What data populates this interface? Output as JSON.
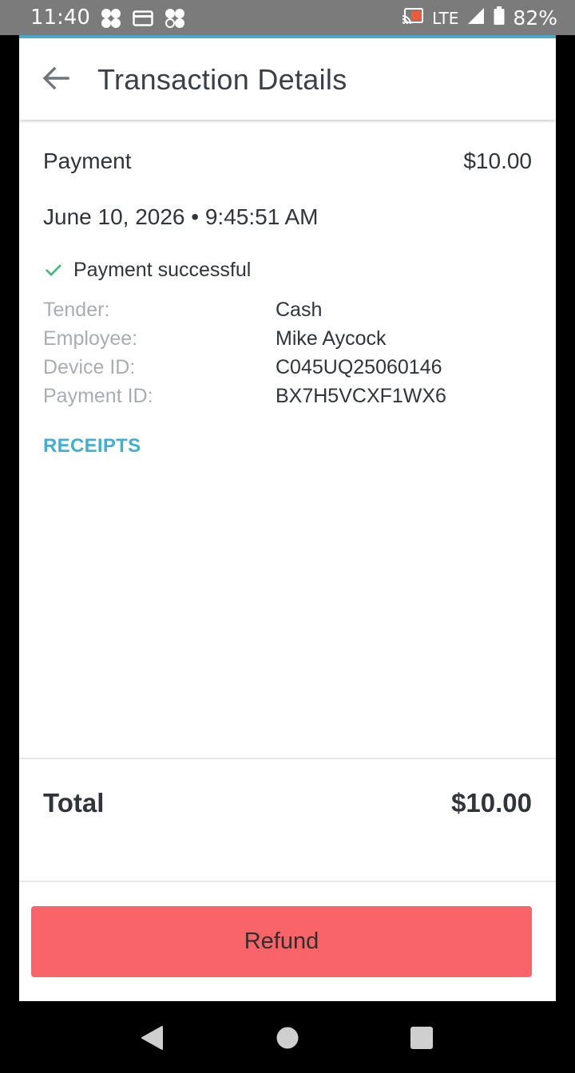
{
  "status_bar": {
    "time": "11:40",
    "network": "LTE",
    "battery": "82%"
  },
  "appbar": {
    "title": "Transaction Details"
  },
  "payment": {
    "label": "Payment",
    "amount": "$10.00",
    "datetime": "June 10, 2026 • 9:45:51 AM",
    "status": "Payment successful"
  },
  "details": [
    {
      "key": "Tender:",
      "value": "Cash"
    },
    {
      "key": "Employee:",
      "value": "Mike Aycock"
    },
    {
      "key": "Device ID:",
      "value": "C045UQ25060146"
    },
    {
      "key": "Payment ID:",
      "value": "BX7H5VCXF1WX6"
    }
  ],
  "receipts_label": "RECEIPTS",
  "total": {
    "label": "Total",
    "amount": "$10.00"
  },
  "refund_label": "Refund",
  "colors": {
    "accent": "#3fb0cf",
    "success": "#3cb878",
    "refund": "#f86468"
  }
}
